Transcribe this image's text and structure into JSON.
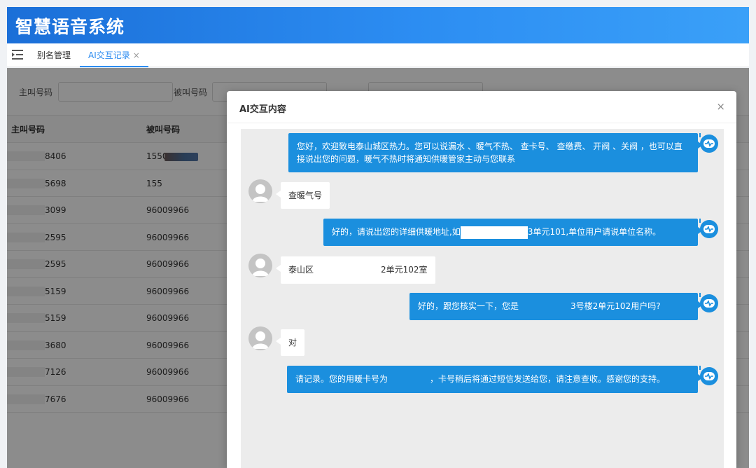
{
  "app": {
    "title": "智慧语音系统"
  },
  "tabs": {
    "menu_icon": "menu-indent-icon",
    "items": [
      {
        "label": "别名管理"
      },
      {
        "label": "AI交互记录",
        "close": "×"
      }
    ]
  },
  "filters": {
    "caller_label": "主叫号码",
    "callee_label": "被叫号码",
    "caller_value": "",
    "callee_value": ""
  },
  "table": {
    "columns": [
      "主叫号码",
      "被叫号码"
    ],
    "rows": [
      {
        "caller": "8406",
        "callee": "1550"
      },
      {
        "caller": "5698",
        "callee": "155"
      },
      {
        "caller": "3099",
        "callee": "96009966"
      },
      {
        "caller": "2595",
        "callee": "96009966"
      },
      {
        "caller": "2595",
        "callee": "96009966"
      },
      {
        "caller": "5159",
        "callee": "96009966"
      },
      {
        "caller": "5159",
        "callee": "96009966"
      },
      {
        "caller": "3680",
        "callee": "96009966"
      },
      {
        "caller": "7126",
        "callee": "96009966"
      },
      {
        "caller": "7676",
        "callee": "96009966"
      }
    ]
  },
  "modal": {
    "title": "AI交互内容",
    "close": "×",
    "messages": [
      {
        "role": "bot",
        "text": "您好，欢迎致电泰山城区热力。您可以说漏水 、暖气不热、 查卡号、 查缴费、 开阀 、关阀 ，也可以直接说出您的问题，暖气不热时将通知供暖管家主动与您联系"
      },
      {
        "role": "user",
        "text": "查暖气号"
      },
      {
        "role": "bot",
        "text_before": "好的，请说出您的详细供暖地址,如",
        "text_after": "3单元101,单位用户请说单位名称。"
      },
      {
        "role": "user",
        "text_before": "泰山区",
        "text_after": "2单元102室"
      },
      {
        "role": "bot",
        "text_before": "好的，跟您核实一下，您是",
        "text_after": "3号楼2单元102用户吗?"
      },
      {
        "role": "user",
        "text": "对"
      },
      {
        "role": "bot",
        "text_before": "请记录。您的用暖卡号为",
        "text_after": "，卡号稍后将通过短信发送给您，请注意查收。感谢您的支持。"
      }
    ]
  },
  "icons": {
    "bot": "robot-icon",
    "user": "user-avatar-icon",
    "close": "close-icon"
  },
  "colors": {
    "header": "#2c8df2",
    "accent": "#2d8cf0",
    "bot_bubble": "#1b8fde"
  }
}
